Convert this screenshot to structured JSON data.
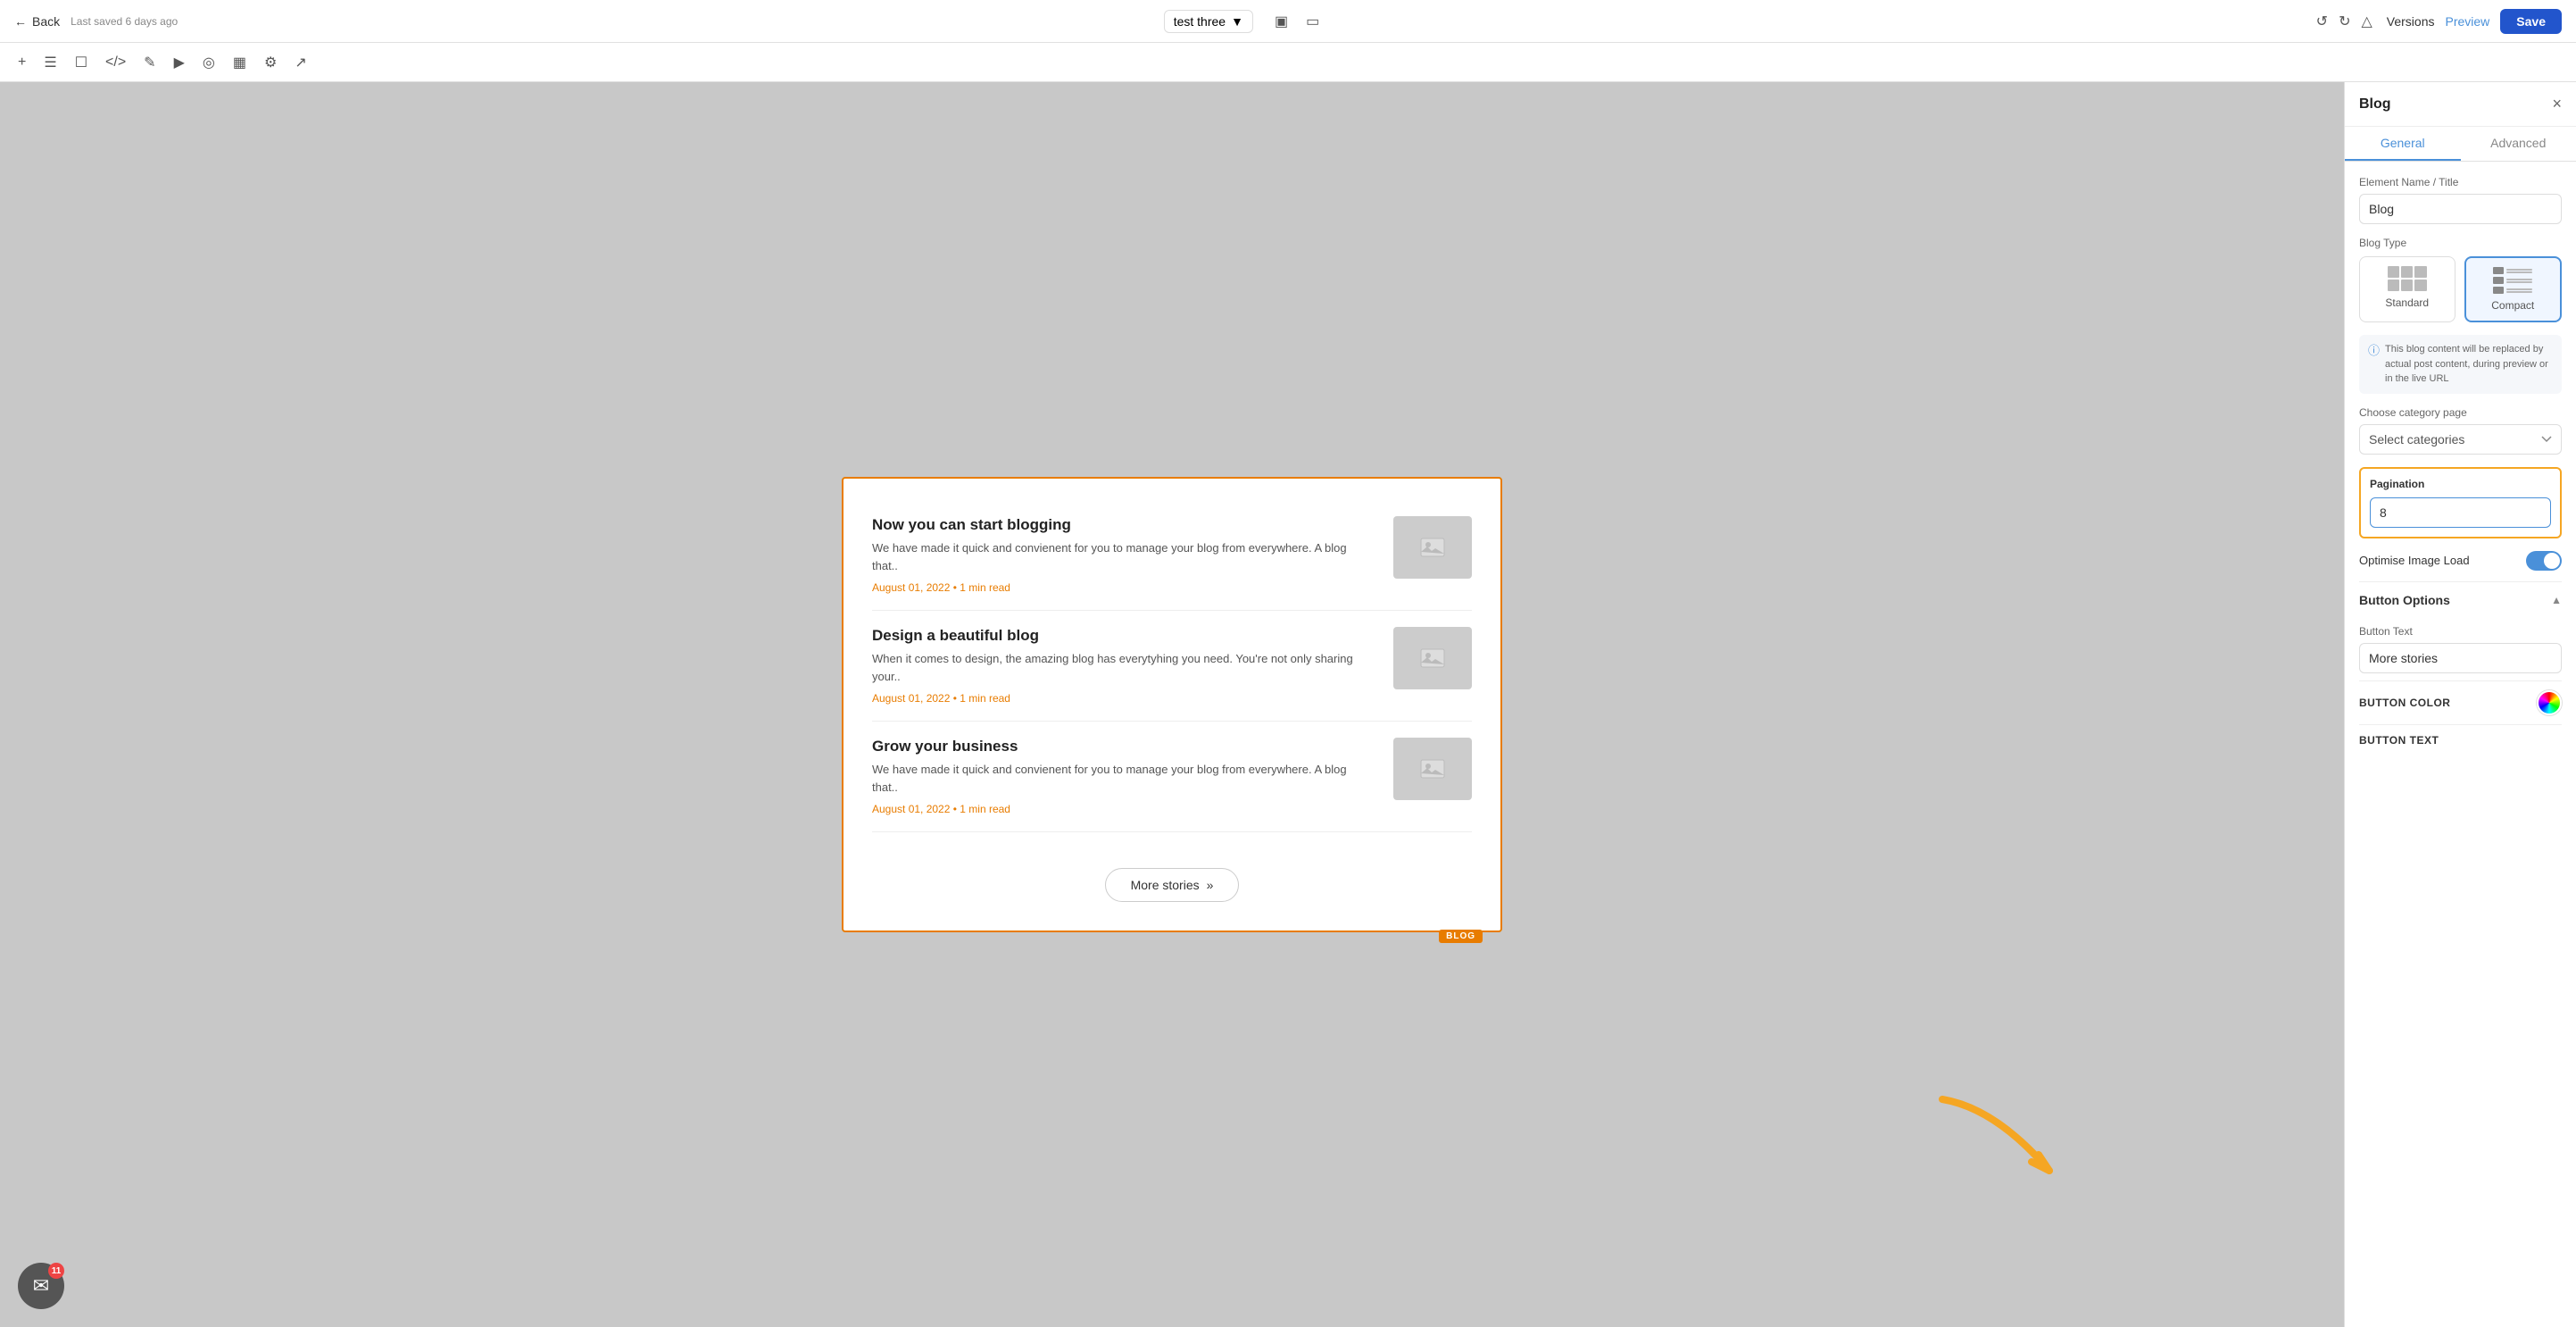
{
  "toolbar": {
    "back_label": "Back",
    "saved_text": "Last saved 6 days ago",
    "project_name": "test three",
    "versions_label": "Versions",
    "preview_label": "Preview",
    "save_label": "Save"
  },
  "blog": {
    "posts": [
      {
        "title": "Now you can start blogging",
        "excerpt": "We have made it quick and convienent for you to manage your blog from everywhere. A blog that..",
        "meta": "August 01, 2022 • 1 min read"
      },
      {
        "title": "Design a beautiful blog",
        "excerpt": "When it comes to design, the amazing blog has everytyhing you need. You're not only sharing your..",
        "meta": "August 01, 2022 • 1 min read"
      },
      {
        "title": "Grow your business",
        "excerpt": "We have made it quick and convienent for you to manage your blog from everywhere. A blog that..",
        "meta": "August 01, 2022 • 1 min read"
      }
    ],
    "more_stories_label": "More stories",
    "badge_label": "BLOG"
  },
  "panel": {
    "title": "Blog",
    "tabs": [
      "General",
      "Advanced"
    ],
    "active_tab": "General",
    "element_name_label": "Element Name / Title",
    "element_name_value": "Blog",
    "blog_type_label": "Blog Type",
    "blog_types": [
      {
        "id": "standard",
        "label": "Standard"
      },
      {
        "id": "compact",
        "label": "Compact"
      }
    ],
    "active_blog_type": "compact",
    "info_text": "This blog content will be replaced by actual post content, during preview or in the live URL",
    "category_label": "Choose category page",
    "category_placeholder": "Select categories",
    "pagination_label": "Pagination",
    "pagination_value": "8",
    "optimise_image_label": "Optimise Image Load",
    "button_options_label": "Button Options",
    "button_text_label": "Button Text",
    "button_text_value": "More stories",
    "button_color_label": "BUTTON COLOR",
    "button_text_section_label": "BUTTON TEXT"
  }
}
